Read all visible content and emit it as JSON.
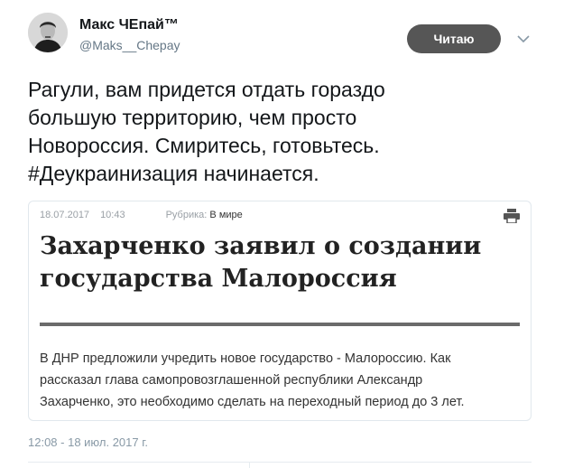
{
  "author": {
    "name": "Макс ЧЕпай™",
    "handle": "@Maks__Chepay"
  },
  "follow_button": {
    "label": "Читаю"
  },
  "tweet": {
    "lines": [
      "Рагули, вам придется отдать гораздо",
      "большую территорию, чем просто",
      "Новороссия. Смиритесь, готовьтесь.",
      "#Деукраинизация начинается."
    ]
  },
  "card": {
    "date": "18.07.2017",
    "time": "10:43",
    "rubric_label": "Рубрика:",
    "rubric_value": "В мире",
    "headline_lines": [
      "Захарченко заявил о создании",
      "государства Малороссия"
    ],
    "lead_lines": [
      "В ДНР предложили учредить новое государство - Малороссию. Как",
      "рассказал глава самопровозглашенной республики Александр",
      "Захарченко, это необходимо сделать на переходный период до 3 лет."
    ],
    "icon": "printer-icon"
  },
  "timestamp": "12:08 - 18 июл. 2017 г.",
  "colors": {
    "follow_bg": "#565656",
    "handle": "#657786",
    "rule": "#6b6b6b"
  }
}
